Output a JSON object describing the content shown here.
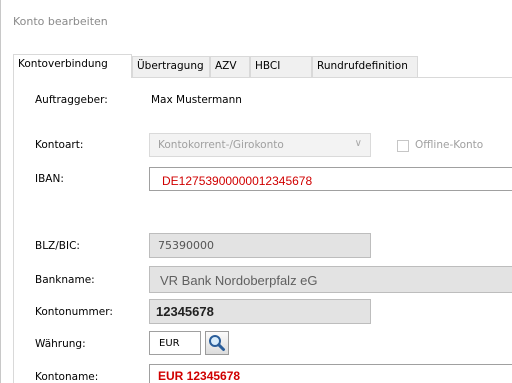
{
  "window": {
    "title": "Konto bearbeiten"
  },
  "tabs": [
    {
      "label": "Kontoverbindung",
      "active": true
    },
    {
      "label": "Übertragung",
      "active": false
    },
    {
      "label": "AZV",
      "active": false
    },
    {
      "label": "HBCI",
      "active": false
    },
    {
      "label": "Rundrufdefinition",
      "active": false
    }
  ],
  "form": {
    "auftraggeber": {
      "label": "Auftraggeber:",
      "value": "Max Mustermann"
    },
    "kontoart": {
      "label": "Kontoart:",
      "value": "Kontokorrent-/Girokonto",
      "disabled": true
    },
    "offline": {
      "label": "Offline-Konto",
      "checked": false,
      "disabled": true
    },
    "iban": {
      "label": "IBAN:",
      "value": "DE12753900000012345678",
      "text_color": "#d00000"
    },
    "blz_bic": {
      "label": "BLZ/BIC:",
      "value": "75390000"
    },
    "bankname": {
      "label": "Bankname:",
      "value": "VR Bank Nordoberpfalz eG"
    },
    "kontonummer": {
      "label": "Kontonummer:",
      "value": "12345678"
    },
    "waehrung": {
      "label": "Währung:",
      "value": "EUR",
      "search_icon": "magnifier-icon"
    },
    "kontoname": {
      "label": "Kontoname:",
      "value": "EUR 12345678",
      "text_color": "#d00000"
    }
  }
}
